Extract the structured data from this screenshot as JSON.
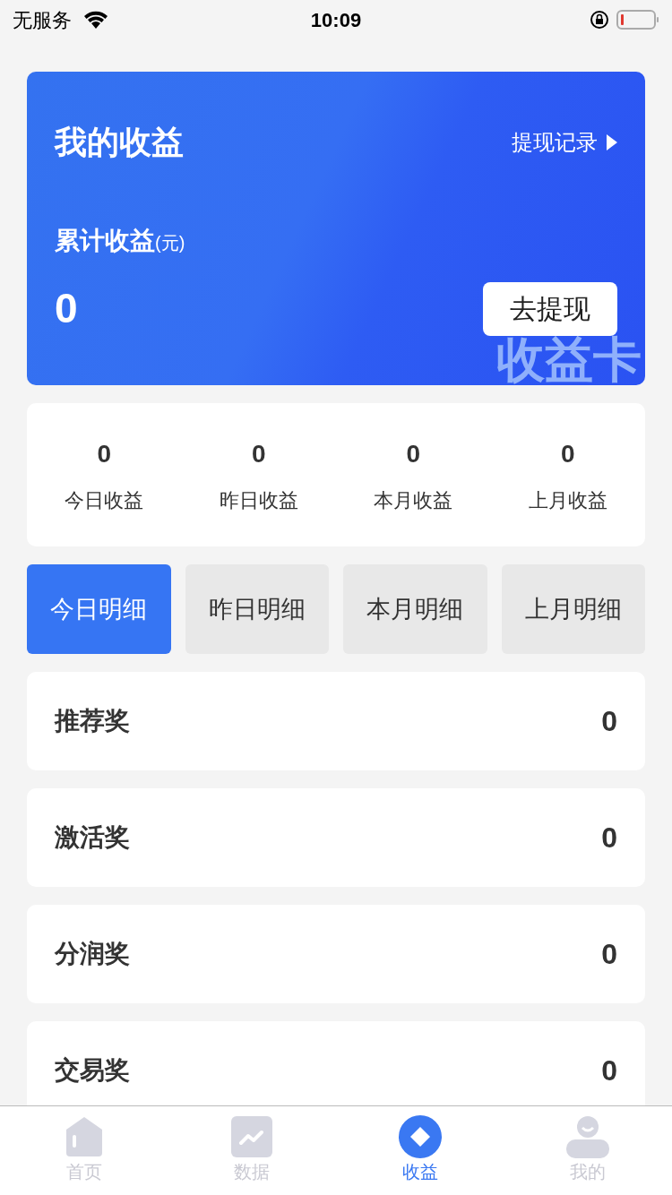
{
  "status_bar": {
    "carrier": "无服务",
    "time": "10:09"
  },
  "earnings_card": {
    "title": "我的收益",
    "history_link": "提现记录",
    "total_label": "累计收益",
    "unit": "(元)",
    "total": "0",
    "withdraw_button": "去提现",
    "decoration": "收益卡"
  },
  "summary": [
    {
      "value": "0",
      "label": "今日收益"
    },
    {
      "value": "0",
      "label": "昨日收益"
    },
    {
      "value": "0",
      "label": "本月收益"
    },
    {
      "value": "0",
      "label": "上月收益"
    }
  ],
  "detail_tabs": [
    {
      "label": "今日明细",
      "selected": true
    },
    {
      "label": "昨日明细",
      "selected": false
    },
    {
      "label": "本月明细",
      "selected": false
    },
    {
      "label": "上月明细",
      "selected": false
    }
  ],
  "rewards": [
    {
      "name": "推荐奖",
      "value": "0"
    },
    {
      "name": "激活奖",
      "value": "0"
    },
    {
      "name": "分润奖",
      "value": "0"
    },
    {
      "name": "交易奖",
      "value": "0"
    }
  ],
  "tab_bar": [
    {
      "kind": "home",
      "label": "首页",
      "selected": false
    },
    {
      "kind": "data",
      "label": "数据",
      "selected": false
    },
    {
      "kind": "earnings",
      "label": "收益",
      "selected": true
    },
    {
      "kind": "profile",
      "label": "我的",
      "selected": false
    }
  ]
}
